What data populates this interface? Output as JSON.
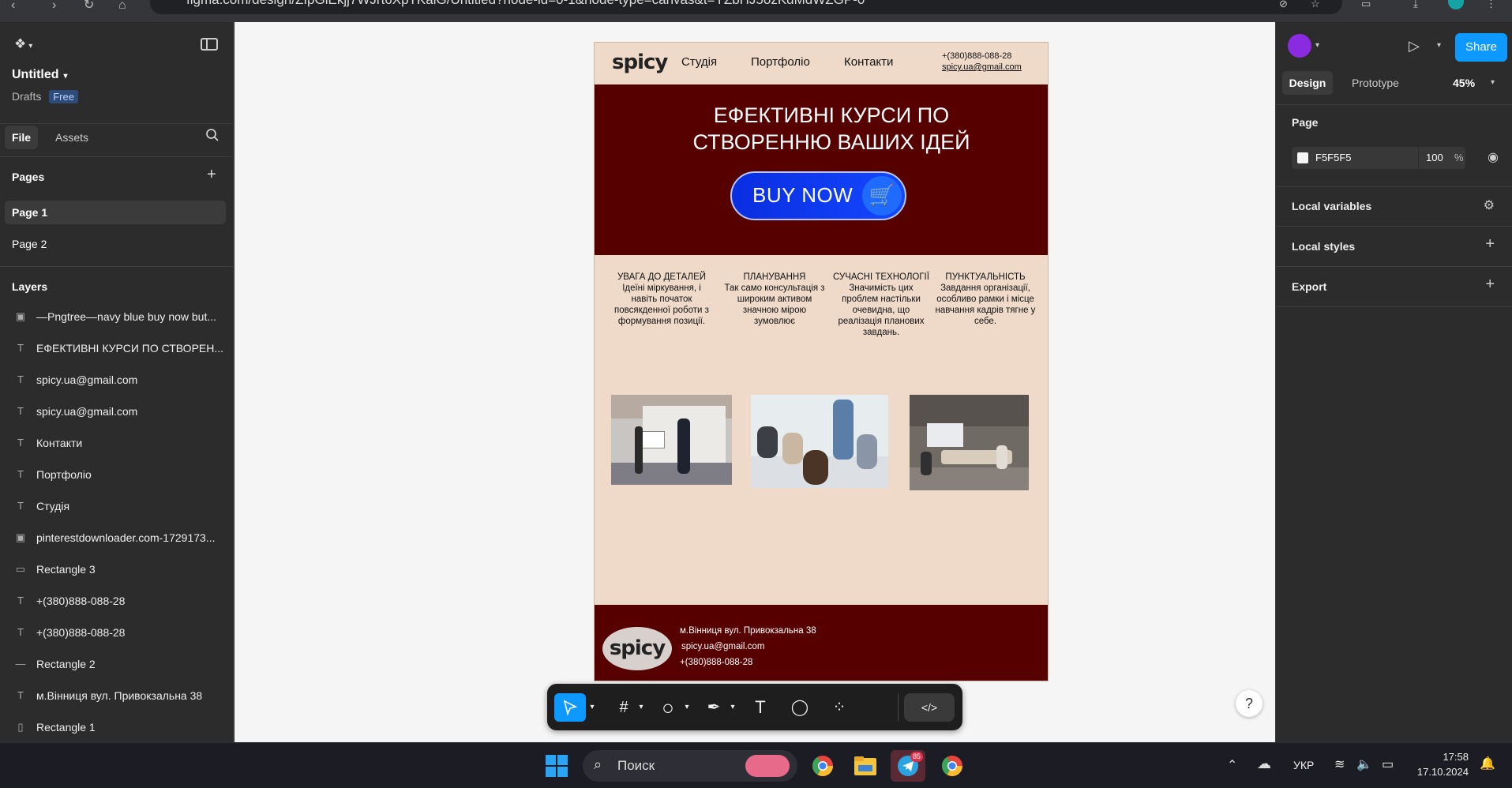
{
  "browser": {
    "url": "figma.com/design/ZIpGlEkjj7WJrt6XpTKaiG/Untitled?node-id=0-1&node-type=canvas&t=YZbHJ5ozKdMdWZGP-0"
  },
  "left_panel": {
    "file_name": "Untitled",
    "location": "Drafts",
    "plan_badge": "Free",
    "tabs": [
      "File",
      "Assets"
    ],
    "pages_title": "Pages",
    "pages": [
      "Page 1",
      "Page 2"
    ],
    "layers_title": "Layers",
    "layers": [
      {
        "icon": "image-icon",
        "name": "—Pngtree—navy blue buy now but..."
      },
      {
        "icon": "text-icon",
        "name": "ЕФЕКТИВНІ КУРСИ ПО СТВОРЕН..."
      },
      {
        "icon": "text-icon",
        "name": "spicy.ua@gmail.com"
      },
      {
        "icon": "text-icon",
        "name": "spicy.ua@gmail.com"
      },
      {
        "icon": "text-icon",
        "name": "Контакти"
      },
      {
        "icon": "text-icon",
        "name": "Портфоліо"
      },
      {
        "icon": "text-icon",
        "name": "Студія"
      },
      {
        "icon": "image-icon",
        "name": "pinterestdownloader.com-1729173..."
      },
      {
        "icon": "rectangle-icon",
        "name": "Rectangle 3"
      },
      {
        "icon": "text-icon",
        "name": "+(380)888-088-28"
      },
      {
        "icon": "text-icon",
        "name": "+(380)888-088-28"
      },
      {
        "icon": "line-icon",
        "name": "Rectangle 2"
      },
      {
        "icon": "text-icon",
        "name": "м.Вінниця вул. Привокзальна 38"
      },
      {
        "icon": "rectangle-icon",
        "name": "Rectangle 1"
      }
    ]
  },
  "design": {
    "logo": "spicy",
    "nav": [
      "Студія",
      "Портфоліо",
      "Контакти"
    ],
    "phone": "+(380)888-088-28",
    "email": "spicy.ua@gmail.com",
    "hero_title": "ЕФЕКТИВНІ КУРСИ ПО СТВОРЕННЮ ВАШИХ ІДЕЙ",
    "buy_label": "BUY NOW",
    "features": [
      {
        "title": "УВАГА ДО ДЕТАЛЕЙ",
        "text": "Ідеїні міркування, і навіть початок повсякденної роботи з формування позиції."
      },
      {
        "title": "ПЛАНУВАННЯ",
        "text": "Так само консультація з широким активом значною мірою зумовлює"
      },
      {
        "title": "СУЧАСНІ ТЕХНОЛОГІЇ",
        "text": "Значимість цих проблем настільки очевидна, що реалізація планових завдань."
      },
      {
        "title": "ПУНКТУАЛЬНІСТЬ",
        "text": "Завдання організації, особливо рамки і місце навчання кадрів тягне у себе."
      }
    ],
    "footer_address": "м.Вінниця вул. Привокзальна 38",
    "footer_email": "spicy.ua@gmail.com",
    "footer_phone": "+(380)888-088-28",
    "colors": {
      "hero_bg": "#560000",
      "frame_bg": "#efdac9",
      "button": "#1448ff"
    }
  },
  "right_panel": {
    "share_label": "Share",
    "tabs": [
      "Design",
      "Prototype"
    ],
    "zoom": "45%",
    "page_label": "Page",
    "page_color": "F5F5F5",
    "page_opacity": "100",
    "percent": "%",
    "local_variables": "Local variables",
    "local_styles": "Local styles",
    "export": "Export"
  },
  "taskbar": {
    "search_placeholder": "Поиск",
    "language": "УКР",
    "time": "17:58",
    "date": "17.10.2024",
    "telegram_badge": "85"
  }
}
